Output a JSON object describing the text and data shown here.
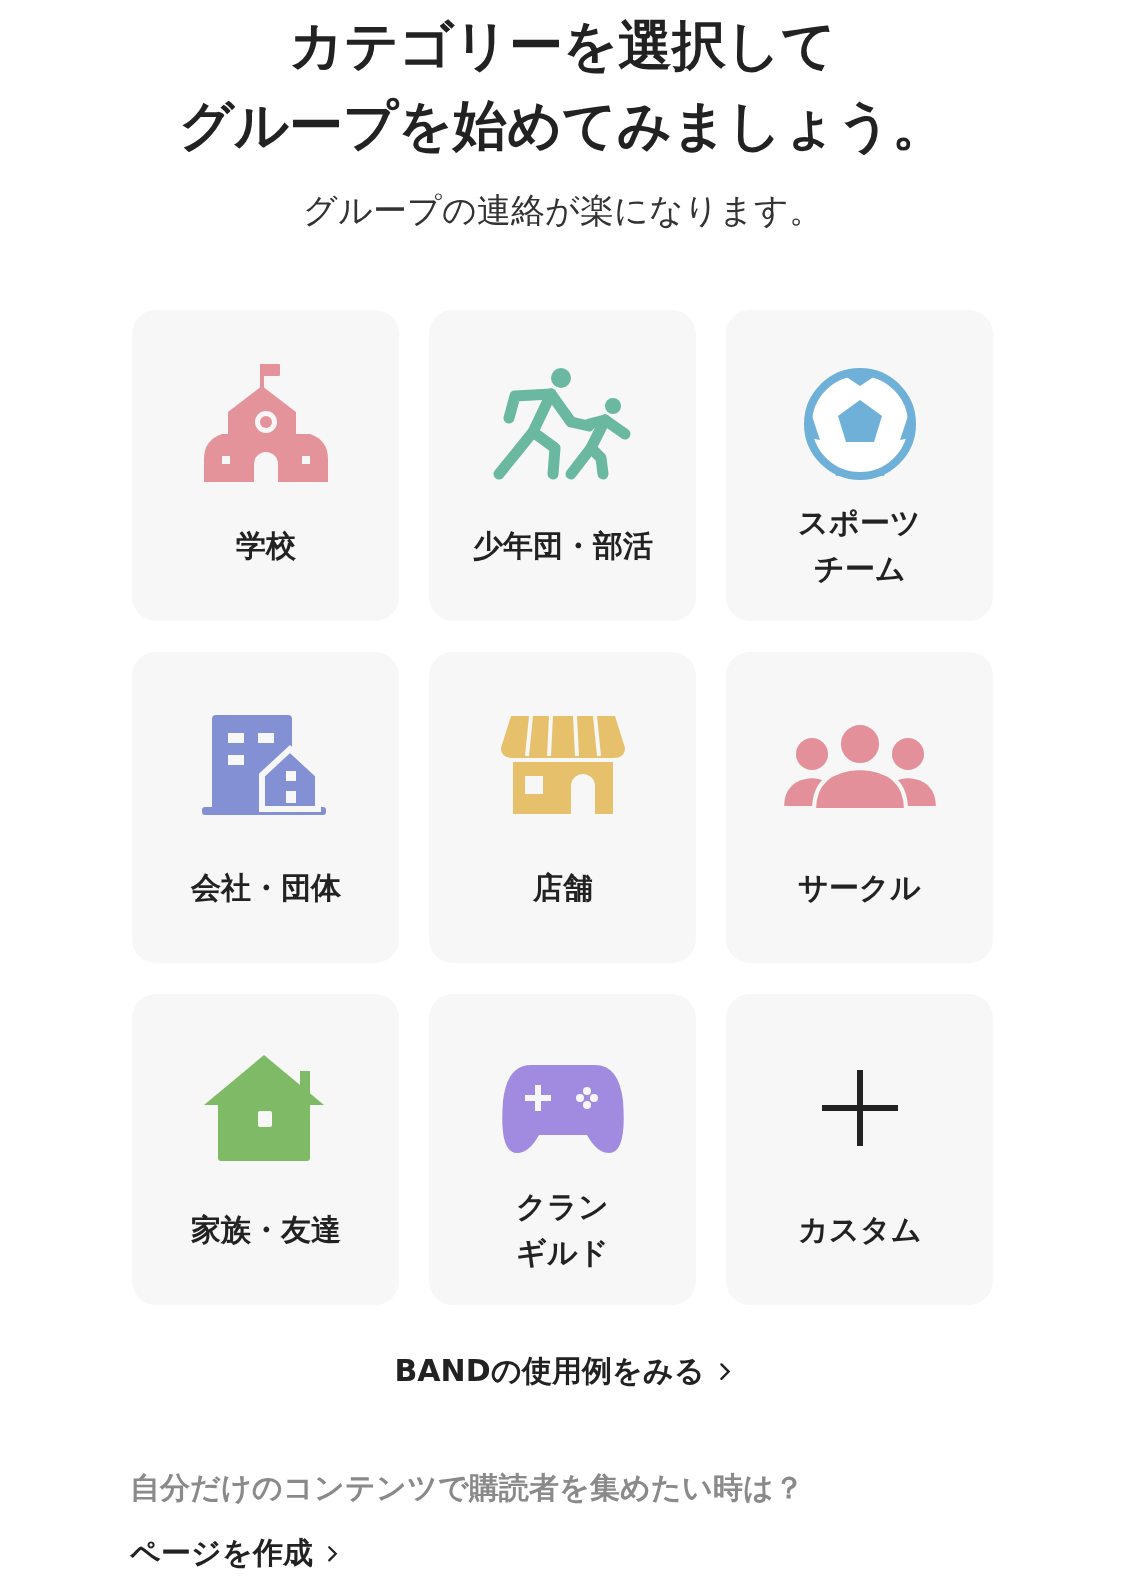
{
  "title_lines": [
    "カテゴリーを選択して",
    "グループを始めてみましょう。"
  ],
  "subtitle": "グループの連絡が楽になります。",
  "categories": [
    {
      "kind": "school",
      "label": "学校"
    },
    {
      "kind": "kids",
      "label": "少年団・部活"
    },
    {
      "kind": "soccer",
      "label_lines": [
        "スポーツ",
        "チーム"
      ]
    },
    {
      "kind": "office",
      "label": "会社・団体"
    },
    {
      "kind": "shop",
      "label": "店舗"
    },
    {
      "kind": "people",
      "label": "サークル"
    },
    {
      "kind": "house",
      "label": "家族・友達"
    },
    {
      "kind": "game",
      "label_lines": [
        "クラン",
        "ギルド"
      ]
    },
    {
      "kind": "plus",
      "label": "カスタム"
    }
  ],
  "examples_link": "BANDの使用例をみる",
  "page_prompt": "自分だけのコンテンツで購読者を集めたい時は？",
  "page_link": "ページを作成"
}
